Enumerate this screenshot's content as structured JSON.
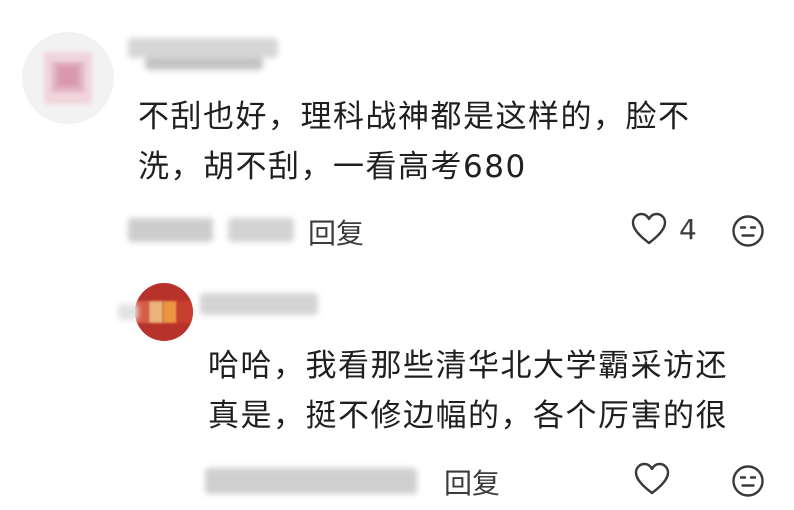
{
  "comments": [
    {
      "text_lines": [
        "不刮也好，理科战神都是这样的，脸不",
        "洗，胡不刮，一看高考680"
      ],
      "reply_label": "回复",
      "like_count": "4",
      "icons": {
        "like": "heart-outline-icon",
        "emoji": "emoji-face-icon"
      }
    },
    {
      "text_lines": [
        "哈哈，我看那些清华北大学霸采访还",
        "真是，挺不修边幅的，各个厉害的很"
      ],
      "reply_label": "回复",
      "like_count": "",
      "icons": {
        "like": "heart-outline-icon",
        "emoji": "emoji-face-icon"
      }
    }
  ],
  "colors": {
    "text": "#1f1f1f",
    "secondary_text": "#3c3c3c",
    "icon": "#3a3a3a",
    "avatar_2": "#b8322c"
  }
}
